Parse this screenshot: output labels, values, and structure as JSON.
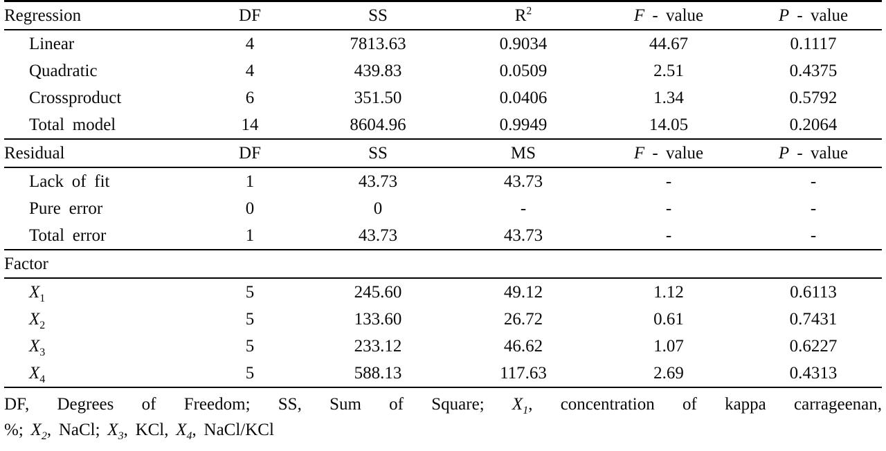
{
  "table": {
    "columns": [
      {
        "key": "label",
        "header_regression": "Regression",
        "header_residual": "Residual",
        "header_factor": "Factor"
      },
      {
        "key": "df",
        "header": "DF"
      },
      {
        "key": "ss",
        "header": "SS"
      },
      {
        "key": "third",
        "header_regression": "R",
        "header_regression_sup": "2",
        "header_residual": "MS"
      },
      {
        "key": "f",
        "header_italic": "F",
        "header_rest": "- value"
      },
      {
        "key": "p",
        "header_italic": "P",
        "header_rest": "- value"
      }
    ],
    "sections": [
      {
        "name": "regression",
        "header": {
          "label": "Regression",
          "df": "DF",
          "ss": "SS",
          "third_base": "R",
          "third_sup": "2",
          "f_italic": "F",
          "f_rest": "- value",
          "p_italic": "P",
          "p_rest": "- value"
        },
        "rows": [
          {
            "label": "Linear",
            "df": "4",
            "ss": "7813.63",
            "third": "0.9034",
            "f": "44.67",
            "p": "0.1117"
          },
          {
            "label": "Quadratic",
            "df": "4",
            "ss": "439.83",
            "third": "0.0509",
            "f": "2.51",
            "p": "0.4375"
          },
          {
            "label": "Crossproduct",
            "df": "6",
            "ss": "351.50",
            "third": "0.0406",
            "f": "1.34",
            "p": "0.5792"
          },
          {
            "label": "Total  model",
            "df": "14",
            "ss": "8604.96",
            "third": "0.9949",
            "f": "14.05",
            "p": "0.2064"
          }
        ]
      },
      {
        "name": "residual",
        "header": {
          "label": "Residual",
          "df": "DF",
          "ss": "SS",
          "third_base": "MS",
          "third_sup": "",
          "f_italic": "F",
          "f_rest": "- value",
          "p_italic": "P",
          "p_rest": "- value"
        },
        "rows": [
          {
            "label": "Lack  of  fit",
            "df": "1",
            "ss": "43.73",
            "third": "43.73",
            "f": "-",
            "p": "-"
          },
          {
            "label": "Pure  error",
            "df": "0",
            "ss": "0",
            "third": "-",
            "f": "-",
            "p": "-"
          },
          {
            "label": "Total  error",
            "df": "1",
            "ss": "43.73",
            "third": "43.73",
            "f": "-",
            "p": "-"
          }
        ]
      },
      {
        "name": "factor",
        "header": {
          "label": "Factor",
          "df": "",
          "ss": "",
          "third_base": "",
          "third_sup": "",
          "f_italic": "",
          "f_rest": "",
          "p_italic": "",
          "p_rest": ""
        },
        "rows": [
          {
            "label_base": "X",
            "label_sub": "1",
            "df": "5",
            "ss": "245.60",
            "third": "49.12",
            "f": "1.12",
            "p": "0.6113"
          },
          {
            "label_base": "X",
            "label_sub": "2",
            "df": "5",
            "ss": "133.60",
            "third": "26.72",
            "f": "0.61",
            "p": "0.7431"
          },
          {
            "label_base": "X",
            "label_sub": "3",
            "df": "5",
            "ss": "233.12",
            "third": "46.62",
            "f": "1.07",
            "p": "0.6227"
          },
          {
            "label_base": "X",
            "label_sub": "4",
            "df": "5",
            "ss": "588.13",
            "third": "117.63",
            "f": "2.69",
            "p": "0.4313"
          }
        ]
      }
    ]
  },
  "footnote": {
    "line1_part1": "DF,  Degrees  of  Freedom;  SS,  Sum  of  Square;  ",
    "line1_x": "X",
    "line1_x_sub": "1",
    "line1_part2": ",  concentration  of  kappa  carrageenan,",
    "line2_part1": "%;  ",
    "line2_x2": "X",
    "line2_x2_sub": "2",
    "line2_part2": ",  NaCl;  ",
    "line2_x3": "X",
    "line2_x3_sub": "3",
    "line2_part3": ",  KCl,  ",
    "line2_x4": "X",
    "line2_x4_sub": "4",
    "line2_part4": ",  NaCl/KCl"
  },
  "colors": {
    "text": "#0a0a0a",
    "rule": "#000000",
    "background": "#ffffff"
  }
}
